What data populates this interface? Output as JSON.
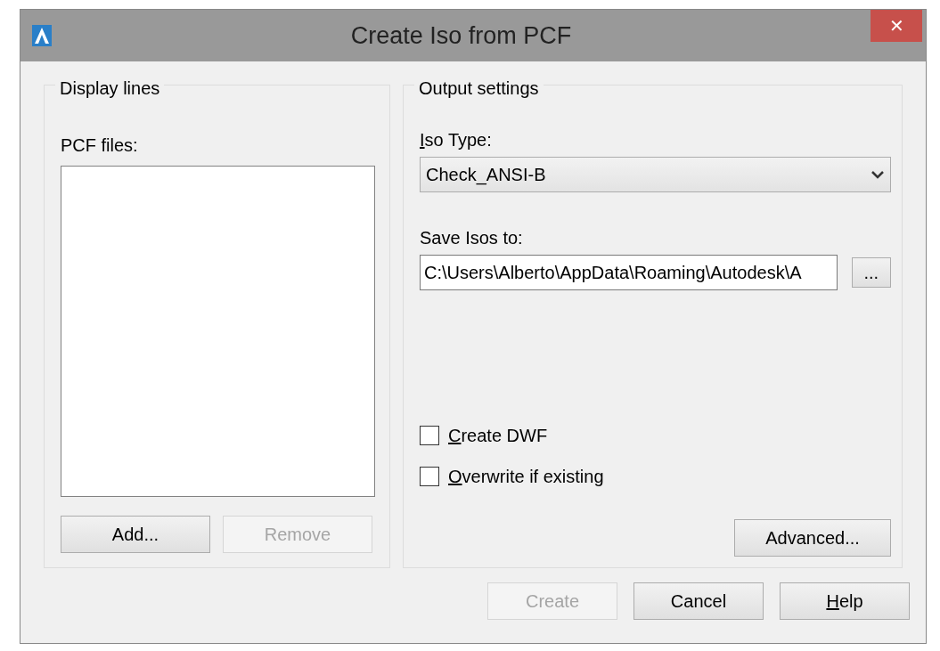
{
  "window": {
    "title": "Create Iso from PCF",
    "close": "✕"
  },
  "display_lines": {
    "title": "Display lines",
    "list_label": "PCF files:",
    "buttons": [
      {
        "label": "Add...",
        "disabled": false
      },
      {
        "label": "Remove",
        "disabled": true
      }
    ]
  },
  "output_settings": {
    "title": "Output settings",
    "iso_type": {
      "label": "Iso Type:",
      "underlined_key": true,
      "value": "Check_ANSI-B"
    },
    "save_to": {
      "label": "Save Isos to:",
      "underlined_key": false,
      "value": "C:\\Users\\Alberto\\AppData\\Roaming\\Autodesk\\A",
      "browse": "..."
    },
    "options": [
      {
        "label": "Create DWF",
        "checked": false,
        "underlined_key": true
      },
      {
        "label": "Overwrite if existing",
        "checked": false,
        "underlined_key": true
      }
    ],
    "advanced": {
      "label": "Advanced...",
      "disabled": false
    }
  },
  "buttons": [
    {
      "label": "Create",
      "disabled": true,
      "underlined_key": false
    },
    {
      "label": "Cancel",
      "disabled": false,
      "underlined_key": false
    },
    {
      "label": "Help",
      "disabled": false,
      "underlined_key": true
    }
  ]
}
